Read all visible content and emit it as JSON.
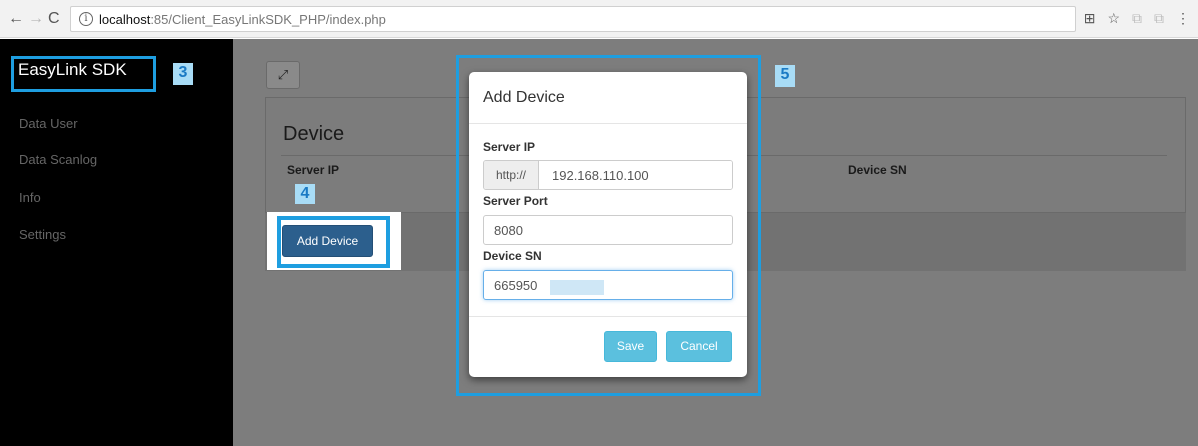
{
  "browser": {
    "url_host": "localhost",
    "url_path": ":85/Client_EasyLinkSDK_PHP/index.php",
    "info_glyph": "i",
    "nav_back": "←",
    "nav_forward": "→",
    "nav_reload": "C",
    "icons": [
      "translate-icon",
      "star-icon",
      "extension-icon",
      "extension-icon",
      "menu-icon"
    ],
    "icon_glyphs": [
      "⊞",
      "☆",
      "⧉",
      "⧉",
      "⋮"
    ]
  },
  "sidebar": {
    "brand": "EasyLink SDK",
    "items": [
      {
        "label": "Data User"
      },
      {
        "label": "Data Scanlog"
      },
      {
        "label": "Info"
      },
      {
        "label": "Settings"
      }
    ]
  },
  "callouts": {
    "c3": "3",
    "c4": "4",
    "c5": "5"
  },
  "main": {
    "expand_glyph": "⤢",
    "panel_title": "Device",
    "columns": [
      "Server IP",
      "Device SN"
    ],
    "add_button": "Add Device"
  },
  "modal": {
    "title": "Add Device",
    "server_ip_label": "Server IP",
    "server_ip_prefix": "http://",
    "server_ip_value": "192.168.110.100",
    "server_port_label": "Server Port",
    "server_port_value": "8080",
    "device_sn_label": "Device SN",
    "device_sn_value": "665950",
    "save_label": "Save",
    "cancel_label": "Cancel"
  },
  "colors": {
    "highlight_frame": "#1e9ee0",
    "primary_button": "#2c5f8d",
    "info_button": "#5bc0de",
    "sidebar_bg": "#000000",
    "backdrop": "#7d7d7d"
  }
}
